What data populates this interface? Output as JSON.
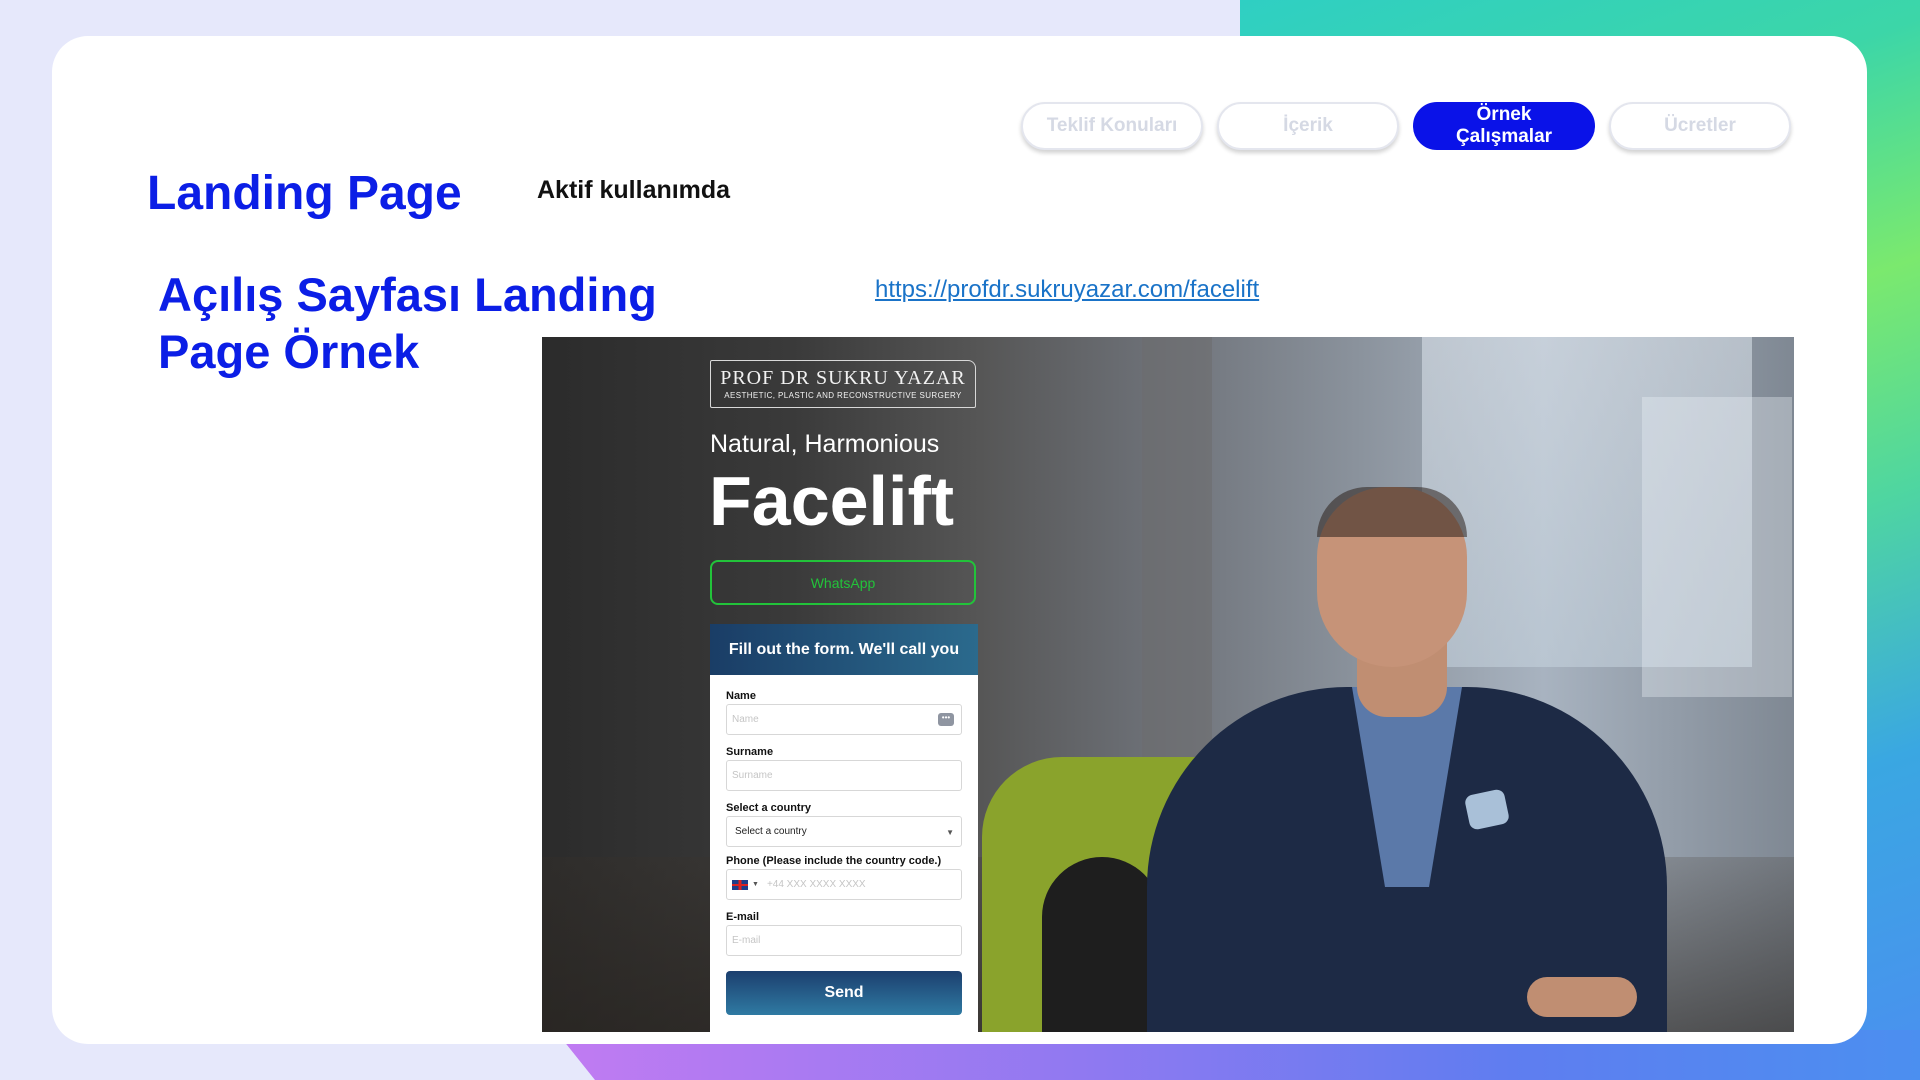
{
  "tabs": [
    {
      "label": "Teklif Konuları",
      "active": false
    },
    {
      "label": "İçerik",
      "active": false
    },
    {
      "label": "Örnek Çalışmalar",
      "active": true
    },
    {
      "label": "Ücretler",
      "active": false
    }
  ],
  "header": {
    "title": "Landing Page",
    "status": "Aktif kullanımda"
  },
  "section": {
    "subtitle": "Açılış Sayfası Landing Page Örnek",
    "url": "https://profdr.sukruyazar.com/facelift"
  },
  "landing": {
    "logo_main": "PROF DR SUKRU YAZAR",
    "logo_sub": "AESTHETIC, PLASTIC AND RECONSTRUCTIVE SURGERY",
    "hero_subtitle": "Natural, Harmonious",
    "hero_title": "Facelift",
    "whatsapp_label": "WhatsApp",
    "form": {
      "heading": "Fill out the form. We'll call you",
      "name_label": "Name",
      "name_placeholder": "Name",
      "surname_label": "Surname",
      "surname_placeholder": "Surname",
      "country_label": "Select a country",
      "country_value": "Select a country",
      "phone_label": "Phone (Please include the country code.)",
      "phone_placeholder": "+44 XXX XXXX XXXX",
      "email_label": "E-mail",
      "email_placeholder": "E-mail",
      "send_label": "Send"
    }
  },
  "colors": {
    "accent_blue": "#0a12e8",
    "link": "#1a73c8",
    "whatsapp_green": "#22c33a"
  }
}
